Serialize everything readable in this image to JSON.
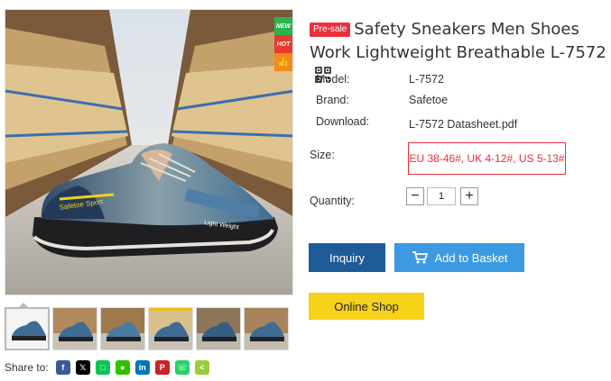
{
  "badges": {
    "new": "NEW",
    "hot": "HOT",
    "like_icon": "thumbs-up-icon"
  },
  "product": {
    "presale_tag": "Pre-sale",
    "title": "Safety Sneakers Men Shoes Work Lightweight Breathable L-7572",
    "qr_icon": "qr-code-icon",
    "image_text": {
      "side_print": "Safetoe Sport",
      "heel_print": "Light Weight"
    }
  },
  "specs": {
    "model_label": "Model:",
    "model_value": "L-7572",
    "brand_label": "Brand:",
    "brand_value": "Safetoe",
    "download_label": "Download:",
    "download_value": "L-7572 Datasheet.pdf"
  },
  "size": {
    "label": "Size:",
    "value": "EU 38-46#, UK 4-12#, US 5-13#"
  },
  "quantity": {
    "label": "Quantity:",
    "value": "1",
    "minus": "−",
    "plus": "+"
  },
  "buttons": {
    "inquiry": "Inquiry",
    "add_to_basket": "Add to Basket",
    "online_shop": "Online Shop"
  },
  "share": {
    "label": "Share to:",
    "networks": [
      "facebook",
      "x",
      "line",
      "wechat",
      "linkedin",
      "pinterest",
      "whatsapp",
      "sharethis"
    ]
  },
  "colors": {
    "presale": "#e8313c",
    "inquiry": "#1e5b99",
    "basket": "#3b9ae1",
    "online_shop": "#f7d21a",
    "size_border": "#e8313c"
  }
}
